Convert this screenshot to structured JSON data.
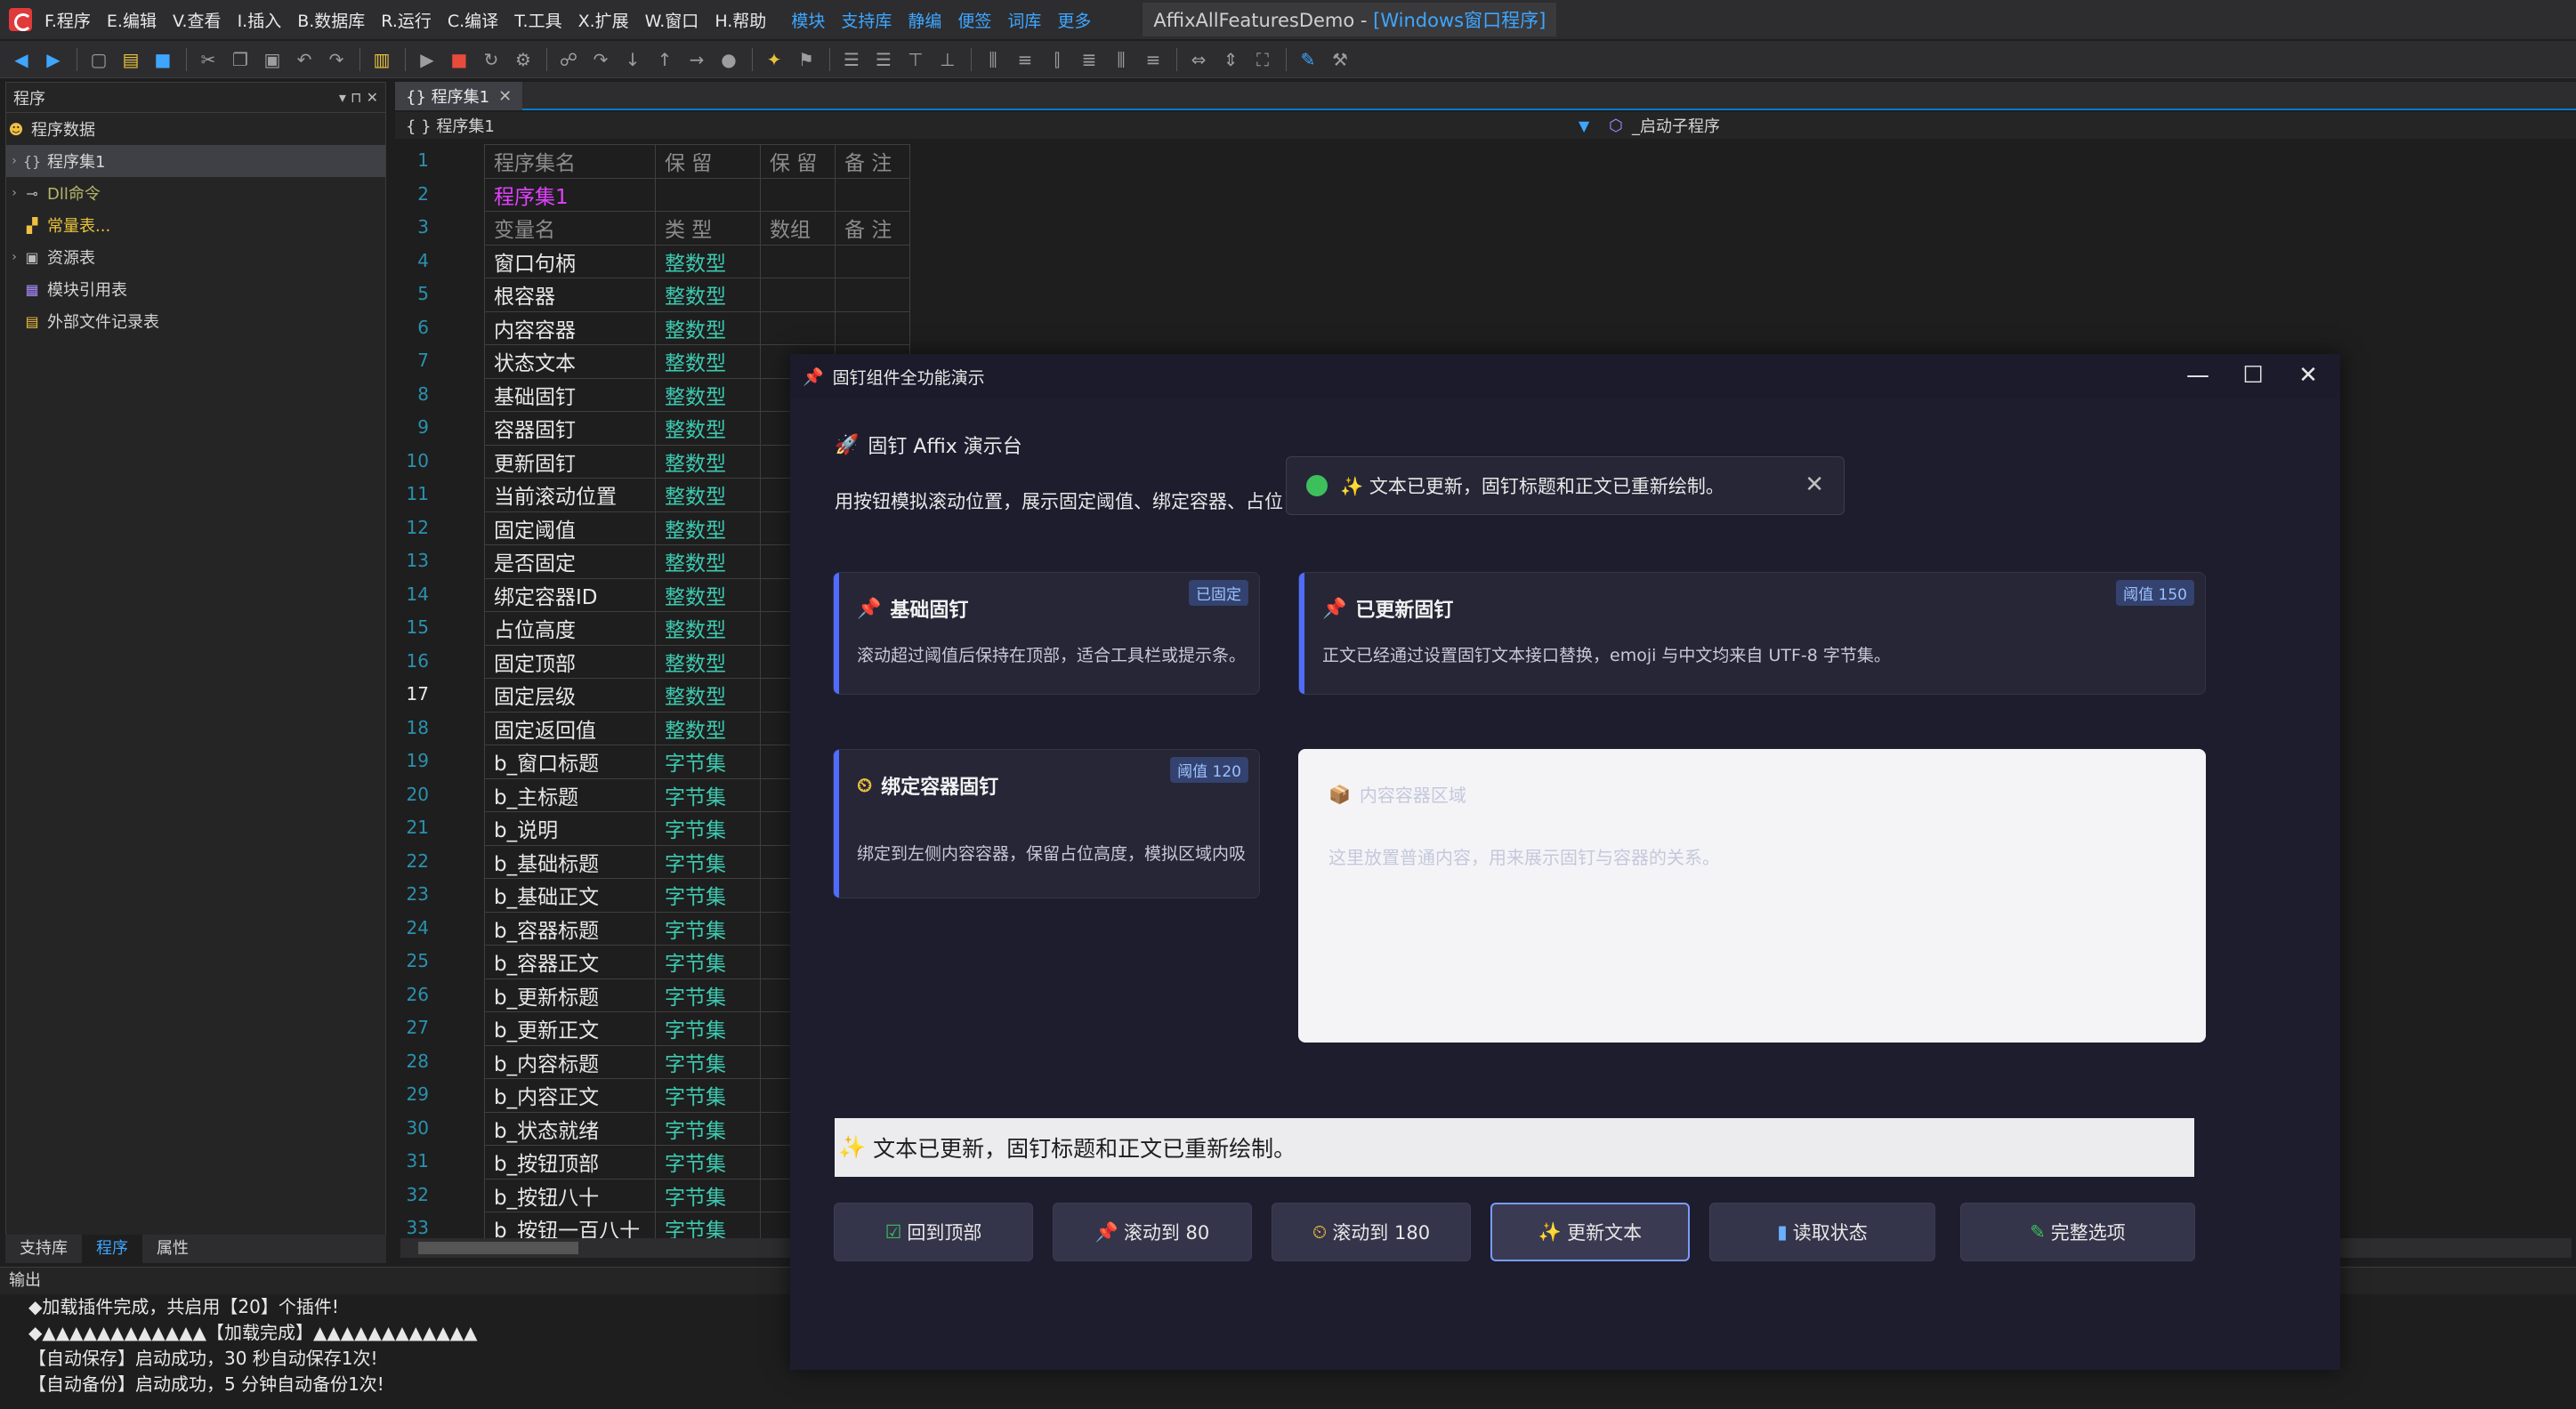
{
  "menubar": {
    "items": [
      "F.程序",
      "E.编辑",
      "V.查看",
      "I.插入",
      "B.数据库",
      "R.运行",
      "C.编译",
      "T.工具",
      "X.扩展",
      "W.窗口",
      "H.帮助"
    ],
    "links": [
      "模块",
      "支持库",
      "静编",
      "便签",
      "词库",
      "更多"
    ],
    "title_main": "AffixAllFeaturesDemo - ",
    "title_suffix": "[Windows窗口程序]"
  },
  "left_panel": {
    "title": "程序",
    "pin": "▾ ⊓ ✕",
    "items": [
      {
        "label": "程序数据",
        "icon": "smile-icon"
      },
      {
        "label": "程序集1",
        "icon": "braces-icon"
      },
      {
        "label": "Dll命令",
        "icon": "link-icon"
      },
      {
        "label": "常量表...",
        "icon": "constant-icon"
      },
      {
        "label": "资源表",
        "icon": "resource-icon"
      },
      {
        "label": "模块引用表",
        "icon": "module-icon"
      },
      {
        "label": "外部文件记录表",
        "icon": "file-icon"
      }
    ],
    "tabs": [
      "支持库",
      "程序",
      "属性"
    ]
  },
  "editor": {
    "tab": "{} 程序集1",
    "path": "{ } 程序集1",
    "sub": "_启动子程序",
    "header1": [
      "程序集名",
      "保 留",
      "保 留",
      "备 注"
    ],
    "class_name": "程序集1",
    "header2": [
      "变量名",
      "类 型",
      "数组",
      "备 注"
    ],
    "rows": [
      [
        "窗口句柄",
        "整数型"
      ],
      [
        "根容器",
        "整数型"
      ],
      [
        "内容容器",
        "整数型"
      ],
      [
        "状态文本",
        "整数型"
      ],
      [
        "基础固钉",
        "整数型"
      ],
      [
        "容器固钉",
        "整数型"
      ],
      [
        "更新固钉",
        "整数型"
      ],
      [
        "当前滚动位置",
        "整数型"
      ],
      [
        "固定阈值",
        "整数型"
      ],
      [
        "是否固定",
        "整数型"
      ],
      [
        "绑定容器ID",
        "整数型"
      ],
      [
        "占位高度",
        "整数型"
      ],
      [
        "固定顶部",
        "整数型"
      ],
      [
        "固定层级",
        "整数型"
      ],
      [
        "固定返回值",
        "整数型"
      ],
      [
        "b_窗口标题",
        "字节集"
      ],
      [
        "b_主标题",
        "字节集"
      ],
      [
        "b_说明",
        "字节集"
      ],
      [
        "b_基础标题",
        "字节集"
      ],
      [
        "b_基础正文",
        "字节集"
      ],
      [
        "b_容器标题",
        "字节集"
      ],
      [
        "b_容器正文",
        "字节集"
      ],
      [
        "b_更新标题",
        "字节集"
      ],
      [
        "b_更新正文",
        "字节集"
      ],
      [
        "b_内容标题",
        "字节集"
      ],
      [
        "b_内容正文",
        "字节集"
      ],
      [
        "b_状态就绪",
        "字节集"
      ],
      [
        "b_按钮顶部",
        "字节集"
      ],
      [
        "b_按钮八十",
        "字节集"
      ],
      [
        "b_按钮一百八十",
        "字节集"
      ]
    ],
    "line_numbers": [
      "1",
      "2",
      "3",
      "4",
      "5",
      "6",
      "7",
      "8",
      "9",
      "10",
      "11",
      "12",
      "13",
      "14",
      "15",
      "16",
      "17",
      "18",
      "19",
      "20",
      "21",
      "22",
      "23",
      "24",
      "25",
      "26",
      "27",
      "28",
      "29",
      "30",
      "31",
      "32",
      "33"
    ]
  },
  "output": {
    "title": "输出",
    "lines": [
      "◆加载插件完成，共启用【20】个插件!",
      "◆▲▲▲▲▲▲▲▲▲▲▲▲【加载完成】▲▲▲▲▲▲▲▲▲▲▲▲",
      "【自动保存】启动成功，30 秒自动保存1次!",
      "【自动备份】启动成功，5 分钟自动备份1次!"
    ]
  },
  "demo": {
    "window_title": "固钉组件全功能演示",
    "stage_title": "固钉 Affix 演示台",
    "stage_desc": "用按钮模拟滚动位置，展示固定阈值、绑定容器、占位",
    "toast": "✨ 文本已更新，固钉标题和正文已重新绘制。",
    "card_basic": {
      "title": "基础固钉",
      "body": "滚动超过阈值后保持在顶部，适合工具栏或提示条。",
      "badge": "已固定"
    },
    "card_updated": {
      "title": "已更新固钉",
      "body": "正文已经通过设置固钉文本接口替换，emoji 与中文均来自 UTF-8 字节集。",
      "badge": "阈值 150"
    },
    "card_bound": {
      "title": "绑定容器固钉",
      "body": "绑定到左侧内容容器，保留占位高度，模拟区域内吸",
      "badge": "阈值 120"
    },
    "card_container": {
      "title": "内容容器区域",
      "body": "这里放置普通内容，用来展示固钉与容器的关系。"
    },
    "status": "文本已更新，固钉标题和正文已重新绘制。",
    "buttons": [
      "回到顶部",
      "滚动到 80",
      "滚动到 180",
      "更新文本",
      "读取状态",
      "完整选项"
    ]
  }
}
